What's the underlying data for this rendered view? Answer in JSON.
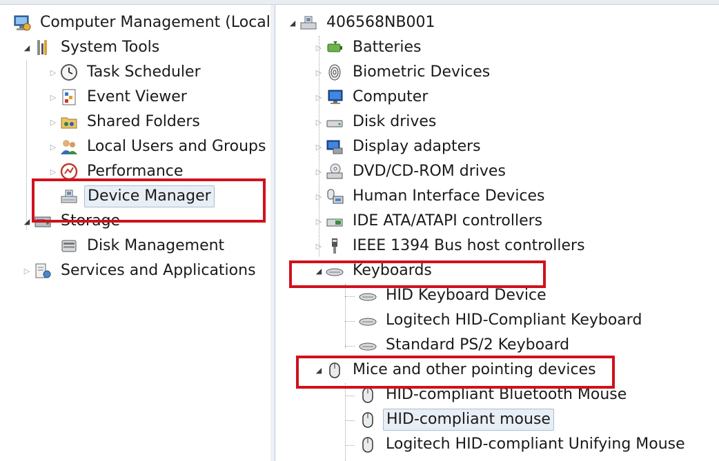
{
  "left_tree": {
    "root": "Computer Management (Local",
    "system_tools": "System Tools",
    "task_scheduler": "Task Scheduler",
    "event_viewer": "Event Viewer",
    "shared_folders": "Shared Folders",
    "local_users": "Local Users and Groups",
    "performance": "Performance",
    "device_manager": "Device Manager",
    "storage": "Storage",
    "disk_management": "Disk Management",
    "services": "Services and Applications"
  },
  "right_tree": {
    "computer_name": "406568NB001",
    "batteries": "Batteries",
    "biometric": "Biometric Devices",
    "computer": "Computer",
    "disk_drives": "Disk drives",
    "display_adapters": "Display adapters",
    "dvd": "DVD/CD-ROM drives",
    "hid": "Human Interface Devices",
    "ide": "IDE ATA/ATAPI controllers",
    "ieee": "IEEE 1394 Bus host controllers",
    "keyboards": "Keyboards",
    "kbd_hid": "HID Keyboard Device",
    "kbd_logitech": "Logitech HID-Compliant Keyboard",
    "kbd_ps2": "Standard PS/2 Keyboard",
    "mice": "Mice and other pointing devices",
    "mouse_bt": "HID-compliant Bluetooth Mouse",
    "mouse_hid": "HID-compliant mouse",
    "mouse_logitech": "Logitech HID-compliant Unifying Mouse"
  },
  "colors": {
    "highlight": "#d0111c",
    "selection": "#e8eef5"
  }
}
